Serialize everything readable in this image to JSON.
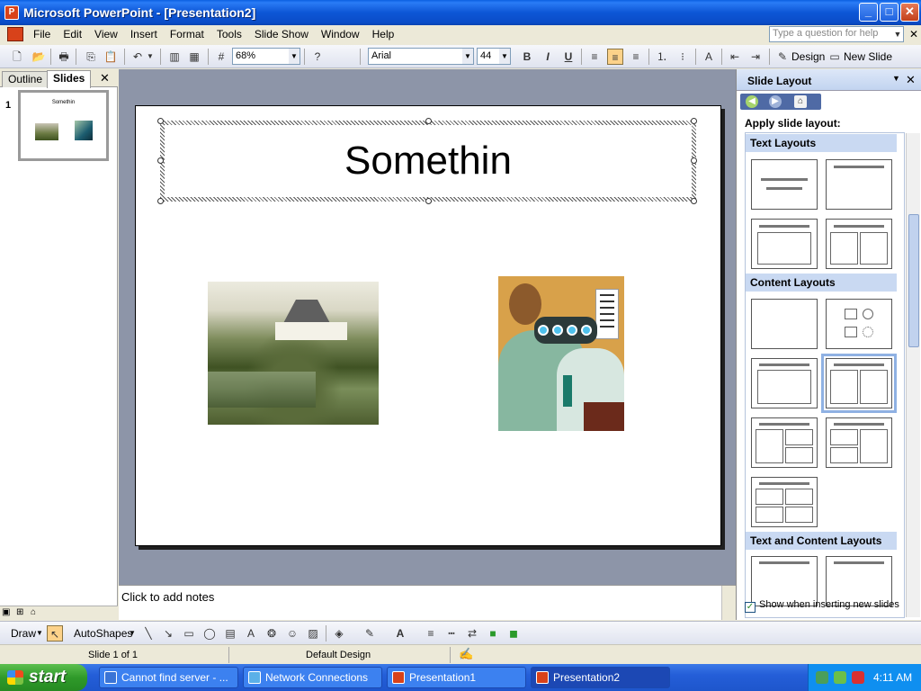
{
  "window": {
    "title": "Microsoft PowerPoint - [Presentation2]",
    "controls": [
      "_",
      "□",
      "✕"
    ]
  },
  "menu": {
    "items": [
      "File",
      "Edit",
      "View",
      "Insert",
      "Format",
      "Tools",
      "Slide Show",
      "Window",
      "Help"
    ],
    "help_placeholder": "Type a question for help"
  },
  "toolbar": {
    "zoom": "68%",
    "font": "Arial",
    "font_size": "44",
    "bold": "B",
    "italic": "I",
    "underline": "U",
    "design_label": "Design",
    "new_slide_label": "New Slide"
  },
  "left_pane": {
    "tabs": [
      "Outline",
      "Slides"
    ],
    "active_tab": "Slides",
    "slide_number": "1",
    "thumb_title": "Somethin"
  },
  "slide": {
    "title": "Somethin"
  },
  "notes": {
    "placeholder": "Click to add notes"
  },
  "task_pane": {
    "title": "Slide Layout",
    "apply_label": "Apply slide layout:",
    "sections": [
      "Text Layouts",
      "Content Layouts",
      "Text and Content Layouts"
    ],
    "checkbox_label": "Show when inserting new slides",
    "checkbox_checked": true
  },
  "draw_toolbar": {
    "draw_label": "Draw",
    "autoshapes_label": "AutoShapes"
  },
  "status_bar": {
    "slide_info": "Slide 1 of 1",
    "design": "Default Design"
  },
  "taskbar": {
    "start_label": "start",
    "tasks": [
      {
        "label": "Cannot find server - ...",
        "active": false
      },
      {
        "label": "Network Connections",
        "active": false
      },
      {
        "label": "Presentation1",
        "active": false
      },
      {
        "label": "Presentation2",
        "active": true
      }
    ],
    "clock": "4:11 AM"
  }
}
